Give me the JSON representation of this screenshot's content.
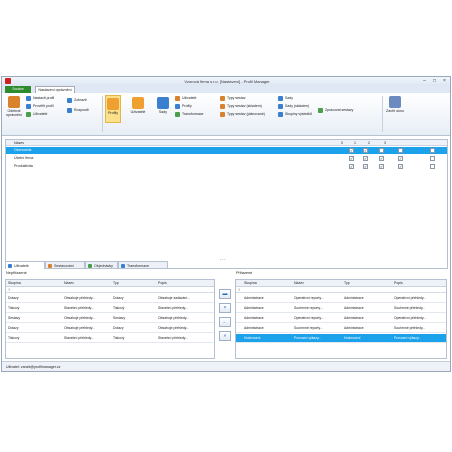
{
  "window": {
    "title": "Vzorová firma s.r.o. [Nastavení] - Profil Manager"
  },
  "tabs": {
    "file": "Soubor",
    "ribbon": "Nastavení oprávnění"
  },
  "ribbon": {
    "big_left": [
      {
        "label": "Odebrat oprávnění",
        "color": "#d9822b"
      }
    ],
    "small_left": [
      {
        "label": "Nastavit profil",
        "color": "#3a7fd0"
      },
      {
        "label": "Prověřit profil",
        "color": "#3a7fd0"
      },
      {
        "label": "Uživatelé",
        "color": "#4aa04a"
      },
      {
        "label": "Zobrazit",
        "color": "#3a7fd0"
      },
      {
        "label": "Rozpustit",
        "color": "#3a7fd0"
      }
    ],
    "big_mid": [
      {
        "label": "Profily",
        "color": "#f0a030",
        "active": true
      },
      {
        "label": "Uživatelé",
        "color": "#f0a030",
        "active": false
      },
      {
        "label": "Sady",
        "color": "#3a7fd0",
        "active": false
      }
    ],
    "small_mid": [
      {
        "label": "Uživatelé",
        "color": "#d9822b"
      },
      {
        "label": "Profily",
        "color": "#3a7fd0"
      },
      {
        "label": "Transformace",
        "color": "#4aa04a"
      },
      {
        "label": "Typy sestav",
        "color": "#d9822b"
      },
      {
        "label": "Typy sestav (skladem)",
        "color": "#d9822b"
      },
      {
        "label": "Typy sestav (plánované)",
        "color": "#d9822b"
      },
      {
        "label": "Sady",
        "color": "#3a7fd0"
      },
      {
        "label": "Sady (skladem)",
        "color": "#3a7fd0"
      },
      {
        "label": "Skupiny výsledků",
        "color": "#3a7fd0"
      },
      {
        "label": "Zpracovat sestavy",
        "color": "#4aa04a"
      }
    ],
    "big_right": {
      "label": "Zavřít okno",
      "color": "#6a8ac0"
    }
  },
  "tree": {
    "header_name": "Název",
    "header_cols": [
      "0",
      "1",
      "2",
      "3"
    ],
    "rows": [
      {
        "name": "Obchodník",
        "selected": true,
        "checks": [
          true,
          true,
          false,
          false,
          false
        ]
      },
      {
        "name": "Účetní firma",
        "selected": false,
        "checks": [
          true,
          true,
          true,
          true,
          false
        ]
      },
      {
        "name": "Produktivita",
        "selected": false,
        "checks": [
          true,
          true,
          true,
          true,
          false
        ]
      }
    ]
  },
  "bottom_tabs": [
    {
      "label": "Uživatelé",
      "color": "#3a7fd0",
      "active": true
    },
    {
      "label": "Sestavování",
      "color": "#d9822b",
      "active": false
    },
    {
      "label": "Objednávky",
      "color": "#4aa04a",
      "active": false
    },
    {
      "label": "Transformace",
      "color": "#3a7fd0",
      "active": false
    }
  ],
  "left_panel": {
    "label": "Nepřiřazené",
    "columns": [
      "Skupina",
      "Název",
      "Typ",
      "Popis"
    ],
    "filter": "Y",
    "rows": [
      [
        "Dotazy",
        "Obsahuje přehledy...",
        "Dotazy",
        "Obsahuje zadávání..."
      ],
      [
        "Tiskový",
        "Stavební přehledy...",
        "Tiskový",
        "Stavební přehledy..."
      ],
      [
        "Sestavy",
        "Obsahuje přehledy...",
        "Sestavy",
        "Obsahuje přehledy..."
      ],
      [
        "Dotazy",
        "Obsahuje přehledy...",
        "Dotazy",
        "Obsahuje přehledy..."
      ],
      [
        "Tiskový",
        "Stavební přehledy...",
        "Tiskový",
        "Stavební přehledy..."
      ]
    ]
  },
  "right_panel": {
    "label": "Přiřazené",
    "columns": [
      "Skupina",
      "Název",
      "Typ",
      "Popis"
    ],
    "filter": "Y",
    "rows": [
      {
        "cells": [
          "Administrace",
          "Operativní reporty...",
          "Administrace",
          "Operativní přehledy..."
        ],
        "selected": false
      },
      {
        "cells": [
          "Administrace",
          "Souhrnné reporty...",
          "Administrace",
          "Souhrnné přehledy..."
        ],
        "selected": false
      },
      {
        "cells": [
          "Administrace",
          "Operativní reporty...",
          "Administrace",
          "Operativní přehledy..."
        ],
        "selected": false
      },
      {
        "cells": [
          "Administrace",
          "Souhrnné reporty...",
          "Administrace",
          "Souhrnné přehledy..."
        ],
        "selected": false
      },
      {
        "cells": [
          "Hodnocení",
          "Provozní výkazy...",
          "Hodnocení",
          "Provozní výkazy..."
        ],
        "selected": true
      }
    ]
  },
  "move_buttons": [
    "▬",
    "×",
    "←",
    "»"
  ],
  "statusbar": {
    "text": "Uživatel: vanek@profilmanager.cz"
  }
}
